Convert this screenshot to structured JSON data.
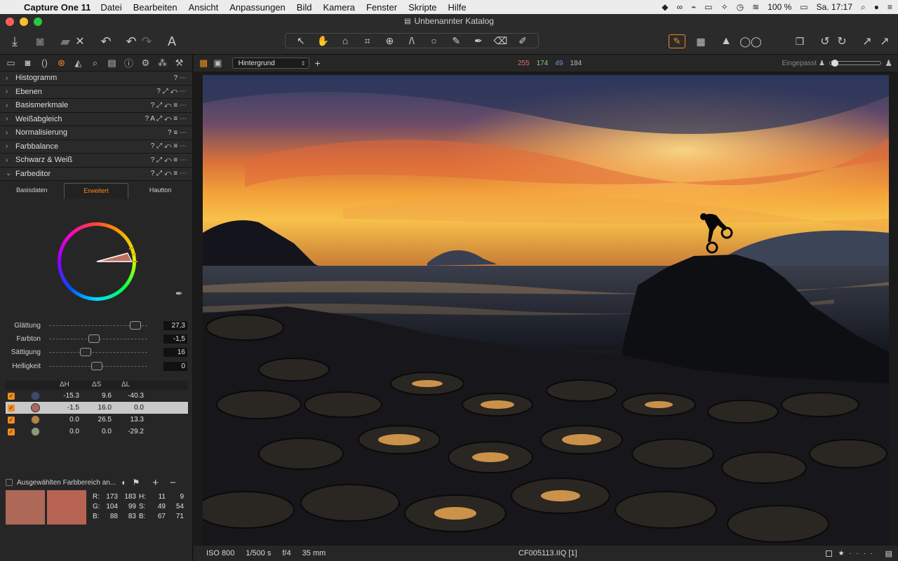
{
  "menubar": {
    "app_name": "Capture One 11",
    "items": [
      "Datei",
      "Bearbeiten",
      "Ansicht",
      "Anpassungen",
      "Bild",
      "Kamera",
      "Fenster",
      "Skripte",
      "Hilfe"
    ],
    "battery": "100 %",
    "clock": "Sa. 17:17"
  },
  "window": {
    "title": "Unbenannter Katalog"
  },
  "tool_tabs_active": "color",
  "sections": [
    {
      "label": "Histogramm",
      "acts": "?  ⋯"
    },
    {
      "label": "Ebenen",
      "acts": "? ⤢ ↶ ⋯"
    },
    {
      "label": "Basismerkmale",
      "acts": "? ⤢ ↶ ≡ ⋯"
    },
    {
      "label": "Weißabgleich",
      "acts": "? A ⤢ ↶ ≡ ⋯"
    },
    {
      "label": "Normalisierung",
      "acts": "? ≡ ⋯"
    },
    {
      "label": "Farbbalance",
      "acts": "? ⤢ ↶ ≡ ⋯"
    },
    {
      "label": "Schwarz & Weiß",
      "acts": "? ⤢ ↶ ≡ ⋯"
    },
    {
      "label": "Farbeditor",
      "acts": "? ⤢ ↶ ≡ ⋯",
      "open": true
    }
  ],
  "color_editor": {
    "subtabs": [
      "Basisdaten",
      "Erweitert",
      "Hautton"
    ],
    "active_subtab": "Erweitert",
    "sliders": [
      {
        "label": "Glättung",
        "value": "27,3",
        "pos": 0.88
      },
      {
        "label": "Farbton",
        "value": "-1,5",
        "pos": 0.46
      },
      {
        "label": "Sättigung",
        "value": "16",
        "pos": 0.37
      },
      {
        "label": "Helligkeit",
        "value": "0",
        "pos": 0.49
      }
    ],
    "table_headers": [
      "ΔH",
      "ΔS",
      "ΔL"
    ],
    "rows": [
      {
        "color": "#3c4a72",
        "dh": "-15.3",
        "ds": "9.6",
        "dl": "-40.3",
        "selected": false
      },
      {
        "color": "#b0695f",
        "dh": "-1.5",
        "ds": "16.0",
        "dl": "0.0",
        "selected": true
      },
      {
        "color": "#b5824a",
        "dh": "0.0",
        "ds": "26.5",
        "dl": "13.3",
        "selected": false
      },
      {
        "color": "#8a9a7c",
        "dh": "0.0",
        "ds": "0.0",
        "dl": "-29.2",
        "selected": false
      }
    ],
    "range_label": "Ausgewählten Farbbereich an...",
    "swatch_before": "#ad6858",
    "swatch_after": "#b76353",
    "rgb": {
      "R": [
        "173",
        "183"
      ],
      "G": [
        "104",
        "99"
      ],
      "B": [
        "88",
        "83"
      ]
    },
    "hsb": {
      "H": [
        "11",
        "9"
      ],
      "S": [
        "49",
        "54"
      ],
      "B": [
        "67",
        "71"
      ]
    }
  },
  "viewer": {
    "layer_select": "Hintergrund",
    "readout": {
      "r": "255",
      "g": "174",
      "b": "49",
      "l": "184"
    },
    "zoom_label": "Eingepasst"
  },
  "status": {
    "iso": "ISO 800",
    "shutter": "1/500 s",
    "aperture": "f/4",
    "focal": "35 mm",
    "filename": "CF005113.IIQ [1]",
    "rating": "★ · · · ·"
  }
}
